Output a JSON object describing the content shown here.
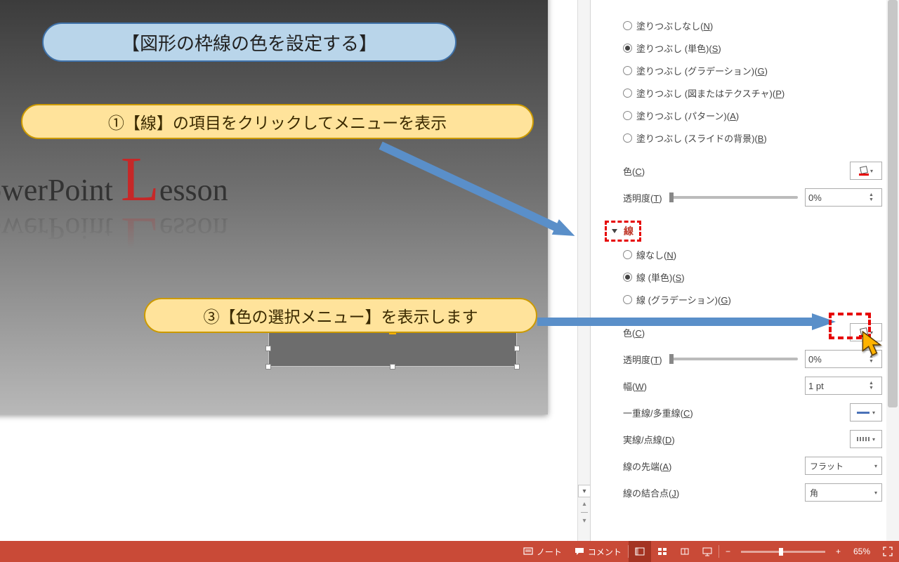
{
  "callouts": {
    "title": "【図形の枠線の色を設定する】",
    "step1": "①【線】の項目をクリックしてメニューを表示",
    "step3": "③【色の選択メニュー】を表示します"
  },
  "slide": {
    "title_prefix": "owerPoint ",
    "title_big_letter": "L",
    "title_suffix": "esson"
  },
  "pane": {
    "fill": {
      "options": {
        "none": {
          "label_pre": "塗りつぶしなし(",
          "key": "N",
          "label_post": ")"
        },
        "solid": {
          "label_pre": "塗りつぶし (単色)(",
          "key": "S",
          "label_post": ")"
        },
        "gradient": {
          "label_pre": "塗りつぶし (グラデーション)(",
          "key": "G",
          "label_post": ")"
        },
        "picture": {
          "label_pre": "塗りつぶし (図またはテクスチャ)(",
          "key": "P",
          "label_post": ")"
        },
        "pattern": {
          "label_pre": "塗りつぶし (パターン)(",
          "key": "A",
          "label_post": ")"
        },
        "slidebg": {
          "label_pre": "塗りつぶし (スライドの背景)(",
          "key": "B",
          "label_post": ")"
        }
      },
      "color": {
        "label_pre": "色(",
        "key": "C",
        "label_post": ")"
      },
      "transparency": {
        "label_pre": "透明度(",
        "key": "T",
        "label_post": ")",
        "value": "0%"
      }
    },
    "line": {
      "section_title": "線",
      "options": {
        "none": {
          "label_pre": "線なし(",
          "key": "N",
          "label_post": ")"
        },
        "solid": {
          "label_pre": "線 (単色)(",
          "key": "S",
          "label_post": ")"
        },
        "gradient": {
          "label_pre": "線 (グラデーション)(",
          "key": "G",
          "label_post": ")"
        }
      },
      "color": {
        "label_pre": "色(",
        "key": "C",
        "label_post": ")"
      },
      "transparency": {
        "label_pre": "透明度(",
        "key": "T",
        "label_post": ")",
        "value": "0%"
      },
      "width": {
        "label_pre": "幅(",
        "key": "W",
        "label_post": ")",
        "value": "1 pt"
      },
      "compound": {
        "label_pre": "一重線/多重線(",
        "key": "C",
        "label_post": ")"
      },
      "dash": {
        "label_pre": "実線/点線(",
        "key": "D",
        "label_post": ")"
      },
      "cap": {
        "label_pre": "線の先端(",
        "key": "A",
        "label_post": ")",
        "value": "フラット"
      },
      "join": {
        "label_pre": "線の結合点(",
        "key": "J",
        "label_post": ")",
        "value": "角"
      }
    }
  },
  "status": {
    "notes": "ノート",
    "comments": "コメント",
    "zoom_pct": "65%",
    "zoom_minus": "−",
    "zoom_plus": "+"
  }
}
